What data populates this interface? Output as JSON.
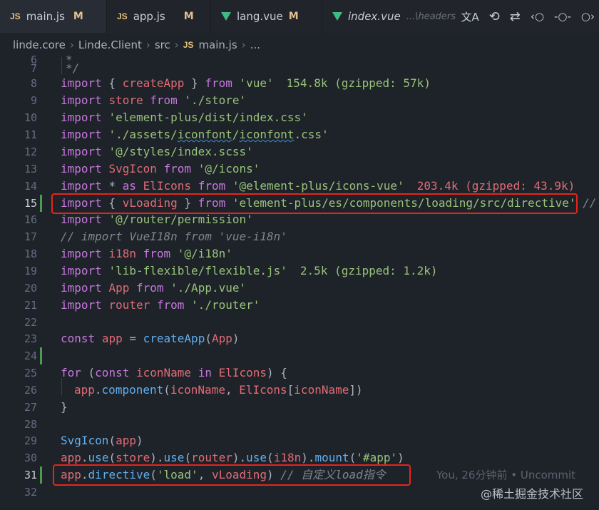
{
  "tabs": [
    {
      "label": "main.js",
      "icon": "JS",
      "status": "M",
      "active": true
    },
    {
      "label": "app.js",
      "icon": "JS",
      "status": "M"
    },
    {
      "label": "lang.vue",
      "icon": "vue",
      "status": "M"
    },
    {
      "label": "index.vue",
      "icon": "vue",
      "path": "...\\headers"
    }
  ],
  "breadcrumb": {
    "p1": "linde.core",
    "p2": "Linde.Client",
    "p3": "src",
    "p4": "main.js",
    "p5": "...",
    "js_icon": "JS"
  },
  "actions": [
    "translate-icon",
    "history-icon",
    "compare-icon",
    "commit-prev-icon",
    "commit-icon",
    "commit-next-icon"
  ],
  "action_glyphs": {
    "a1": "文A",
    "a2": "⟲",
    "a3": "⇄",
    "a4": "‹○",
    "a5": "-○-",
    "a6": "○›"
  },
  "code": {
    "l6": "*",
    "l7": "*/",
    "l8_size": "154.8k (gzipped: 57k)",
    "l14_size": "203.4k (gzipped: 43.9k)",
    "l19_size": "2.5k (gzipped: 1.2k)",
    "l31_comment": "// 自定义load指令",
    "blame": "You, 26分钟前 • Uncommit",
    "l15_comment": "//"
  },
  "line_numbers": [
    "6",
    "7",
    "8",
    "9",
    "10",
    "11",
    "12",
    "13",
    "14",
    "15",
    "16",
    "17",
    "18",
    "19",
    "20",
    "21",
    "22",
    "23",
    "24",
    "25",
    "26",
    "27",
    "28",
    "29",
    "30",
    "31",
    "32"
  ],
  "watermark": "@稀土掘金技术社区",
  "colors": {
    "highlight_box": "#e8241c",
    "keyword": "#c678dd",
    "string": "#98c379",
    "function": "#61afef"
  }
}
